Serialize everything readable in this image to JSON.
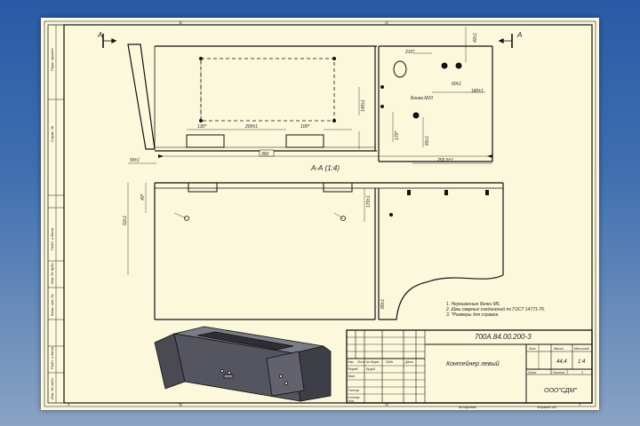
{
  "drawing": {
    "sheet_designation": "700А.84.00.200-3",
    "part_name": "Контейнер левый",
    "mass": "44,4",
    "scale": "1:4",
    "sheet_total": "1",
    "organization": "ООО\"СДМ\"",
    "format": "Формат A3",
    "copied": "Копировал",
    "view_label": "А-А (1:4)",
    "cut_mark": "А",
    "rivet_nut_note": "Бонка М10"
  },
  "title_block": {
    "col_izm": "Изм.",
    "col_list": "Лист",
    "col_docnum": "№ докум.",
    "col_sign": "Подп.",
    "col_date": "Дата",
    "row_razrab": "Разраб.",
    "razrab_name": "Куцый",
    "row_prov": "Пров.",
    "row_tkontr": "Т.контр.",
    "row_nkontr": "Н.контр.",
    "row_utv": "Утв.",
    "lit": "Лит.",
    "massa": "Масса",
    "masshtab": "Масштаб",
    "list_label": "Лист",
    "listov_label": "Листов"
  },
  "notes": [
    "1.  Неуказанные бонки М6.",
    "2.  Швы сварных соединений по ГОСТ 14771-76.",
    "3.  *Размеры для справок."
  ],
  "dimensions": {
    "d200": "200±1",
    "d100": "100*",
    "d130": "130*",
    "d55": "55±1",
    "d350": "350",
    "d255": "255,5±1",
    "d210": "210*",
    "d180": "180±1",
    "d60": "60±1",
    "d42": "42±1",
    "d140": "140±1",
    "d170": "170*",
    "d65": "65±1",
    "d170b": "170±1",
    "d52": "52±1",
    "d80": "80±1",
    "d40": "40*",
    "d180s": "180±1"
  },
  "side_stamps": [
    "Перв. примен.",
    "Справ. №",
    "Подп. и дата",
    "Инв. № дубл.",
    "Взам. инв. №",
    "Подп. и дата",
    "Инв. № подл."
  ],
  "zone_marks": [
    "2",
    "3",
    "4"
  ]
}
